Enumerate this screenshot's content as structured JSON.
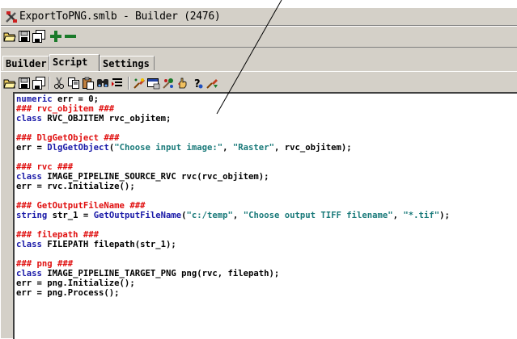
{
  "window": {
    "title": "ExportToPNG.smlb - Builder (2476)"
  },
  "toolbar1": {
    "buttons": [
      "open-folder-icon",
      "save-icon",
      "save-all-icon",
      "plus-icon",
      "minus-icon"
    ]
  },
  "tabs": [
    {
      "label": "Builder",
      "active": false
    },
    {
      "label": "Script",
      "active": true
    },
    {
      "label": "Settings",
      "active": false
    }
  ],
  "toolbar2": {
    "buttons": [
      "open-folder-icon",
      "save-icon",
      "save-all-icon",
      "cut-icon",
      "copy-icon",
      "paste-icon",
      "find-icon",
      "format-icon",
      "run-icon",
      "dialog-icon",
      "tools-icon",
      "hand-icon",
      "help-icon",
      "step-icon"
    ]
  },
  "code": [
    [
      {
        "t": "numeric",
        "c": "kw"
      },
      {
        "t": " err = 0;",
        "c": ""
      }
    ],
    [
      {
        "t": "### rvc_objitem ###",
        "c": "cm"
      }
    ],
    [
      {
        "t": "class",
        "c": "kw"
      },
      {
        "t": " RVC_OBJITEM rvc_objitem;",
        "c": ""
      }
    ],
    [],
    [
      {
        "t": "### DlgGetObject ###",
        "c": "cm"
      }
    ],
    [
      {
        "t": "err = ",
        "c": ""
      },
      {
        "t": "DlgGetObject",
        "c": "fn"
      },
      {
        "t": "(",
        "c": ""
      },
      {
        "t": "\"Choose input image:\"",
        "c": "str"
      },
      {
        "t": ", ",
        "c": ""
      },
      {
        "t": "\"Raster\"",
        "c": "str"
      },
      {
        "t": ", rvc_objitem);",
        "c": ""
      }
    ],
    [],
    [
      {
        "t": "### rvc ###",
        "c": "cm"
      }
    ],
    [
      {
        "t": "class",
        "c": "kw"
      },
      {
        "t": " IMAGE_PIPELINE_SOURCE_RVC rvc(rvc_objitem);",
        "c": ""
      }
    ],
    [
      {
        "t": "err = rvc.Initialize();",
        "c": ""
      }
    ],
    [],
    [
      {
        "t": "### GetOutputFileName ###",
        "c": "cm"
      }
    ],
    [
      {
        "t": "string",
        "c": "kw"
      },
      {
        "t": " str_1 = ",
        "c": ""
      },
      {
        "t": "GetOutputFileName",
        "c": "fn"
      },
      {
        "t": "(",
        "c": ""
      },
      {
        "t": "\"c:/temp\"",
        "c": "str"
      },
      {
        "t": ", ",
        "c": ""
      },
      {
        "t": "\"Choose output TIFF filename\"",
        "c": "str"
      },
      {
        "t": ", ",
        "c": ""
      },
      {
        "t": "\"*.tif\"",
        "c": "str"
      },
      {
        "t": ");",
        "c": ""
      }
    ],
    [],
    [
      {
        "t": "### filepath ###",
        "c": "cm"
      }
    ],
    [
      {
        "t": "class",
        "c": "kw"
      },
      {
        "t": " FILEPATH filepath(str_1);",
        "c": ""
      }
    ],
    [],
    [
      {
        "t": "### png ###",
        "c": "cm"
      }
    ],
    [
      {
        "t": "class",
        "c": "kw"
      },
      {
        "t": " IMAGE_PIPELINE_TARGET_PNG png(rvc, filepath);",
        "c": ""
      }
    ],
    [
      {
        "t": "err = png.Initialize();",
        "c": ""
      }
    ],
    [
      {
        "t": "err = png.Process();",
        "c": ""
      }
    ]
  ],
  "colors": {
    "keyword": "#1a1aa8",
    "comment": "#e01010",
    "string": "#1a7a7a",
    "chrome": "#d4d0c8"
  }
}
